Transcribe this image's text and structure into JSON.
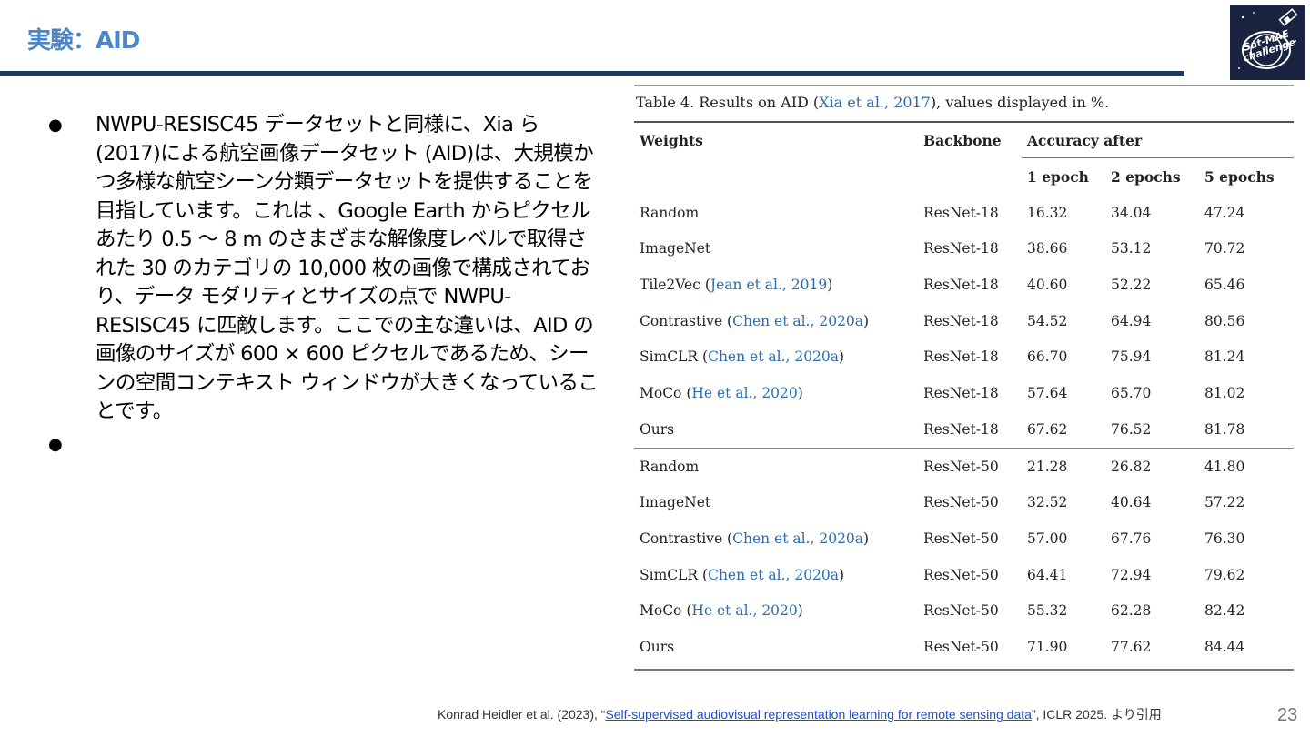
{
  "slide": {
    "title": "実験：AID",
    "page_number": "23",
    "logo_text": "Sat-MAE challenge"
  },
  "body": {
    "bullets": [
      "NWPU-RESISC45 データセットと同様に、Xia ら (2017)による航空画像データセット (AID)は、大規模かつ多様な航空シーン分類データセットを提供することを目指しています。これは 、Google Earth からピクセルあたり 0.5 〜 8 m のさまざまな解像度レベルで取得された 30 のカテゴリの 10,000 枚の画像で構成されており、データ モダリティとサイズの点で NWPU-RESISC45 に匹敵します。ここでの主な違いは、AID の画像のサイズが 600 × 600 ピクセルであるため、シーンの空間コンテキスト ウィンドウが大きくなっていることです。",
      ""
    ]
  },
  "table": {
    "caption_prefix": "Table 4. Results on AID (",
    "caption_cite": "Xia et al., 2017",
    "caption_suffix": "), values displayed in %.",
    "headers": {
      "weights": "Weights",
      "backbone": "Backbone",
      "accuracy_after": "Accuracy after",
      "e1": "1 epoch",
      "e2": "2 epochs",
      "e5": "5 epochs"
    },
    "rows": [
      {
        "name": "Random",
        "cite": "",
        "backbone": "ResNet-18",
        "e1": "16.32",
        "e2": "34.04",
        "e5": "47.24"
      },
      {
        "name": "ImageNet",
        "cite": "",
        "backbone": "ResNet-18",
        "e1": "38.66",
        "e2": "53.12",
        "e5": "70.72"
      },
      {
        "name": "Tile2Vec",
        "cite": "Jean et al., 2019",
        "backbone": "ResNet-18",
        "e1": "40.60",
        "e2": "52.22",
        "e5": "65.46"
      },
      {
        "name": "Contrastive",
        "cite": "Chen et al., 2020a",
        "backbone": "ResNet-18",
        "e1": "54.52",
        "e2": "64.94",
        "e5": "80.56"
      },
      {
        "name": "SimCLR",
        "cite": "Chen et al., 2020a",
        "backbone": "ResNet-18",
        "e1": "66.70",
        "e2": "75.94",
        "e5": "81.24"
      },
      {
        "name": "MoCo",
        "cite": "He et al., 2020",
        "backbone": "ResNet-18",
        "e1": "57.64",
        "e2": "65.70",
        "e5": "81.02"
      },
      {
        "name": "Ours",
        "cite": "",
        "backbone": "ResNet-18",
        "e1": "67.62",
        "e2": "76.52",
        "e5": "81.78"
      },
      {
        "name": "Random",
        "cite": "",
        "backbone": "ResNet-50",
        "e1": "21.28",
        "e2": "26.82",
        "e5": "41.80"
      },
      {
        "name": "ImageNet",
        "cite": "",
        "backbone": "ResNet-50",
        "e1": "32.52",
        "e2": "40.64",
        "e5": "57.22"
      },
      {
        "name": "Contrastive",
        "cite": "Chen et al., 2020a",
        "backbone": "ResNet-50",
        "e1": "57.00",
        "e2": "67.76",
        "e5": "76.30"
      },
      {
        "name": "SimCLR",
        "cite": "Chen et al., 2020a",
        "backbone": "ResNet-50",
        "e1": "64.41",
        "e2": "72.94",
        "e5": "79.62"
      },
      {
        "name": "MoCo",
        "cite": "He et al., 2020",
        "backbone": "ResNet-50",
        "e1": "55.32",
        "e2": "62.28",
        "e5": "82.42"
      },
      {
        "name": "Ours",
        "cite": "",
        "backbone": "ResNet-50",
        "e1": "71.90",
        "e2": "77.62",
        "e5": "84.44"
      }
    ]
  },
  "footer": {
    "prefix": "Konrad Heidler et al. (2023), “",
    "link": "Self-supervised audiovisual representation learning for remote sensing data",
    "suffix": "”, ICLR 2025. より引用"
  }
}
